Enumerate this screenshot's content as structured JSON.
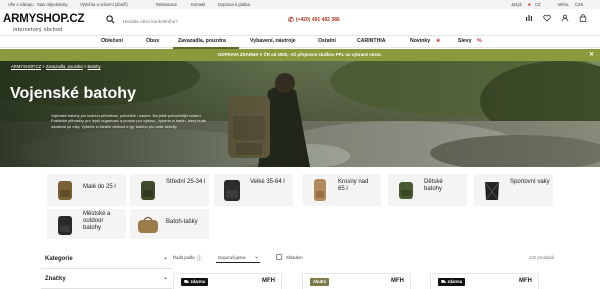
{
  "topbar": {
    "left": [
      "Vše o nákupu",
      "Stav objednávky",
      "Výměna a vrácení (zboží)",
      "Reklamace",
      "Kontakt",
      "Doprava a platba"
    ],
    "jazyk_label": "Jazyk",
    "jazyk_value": "CZ",
    "mena_label": "Měna",
    "mena_value": "CZK"
  },
  "header": {
    "logo": "ARMYSHOP.CZ",
    "logo_sub": "internetový obchod",
    "search_placeholder": "Hledáte něco konkrétního?",
    "phone": "(+420) 491 482 386"
  },
  "nav": {
    "items": [
      "Oblečení",
      "Obuv",
      "Zavazadla, pouzdra",
      "Vybavení, nástroje",
      "Ostatní",
      "CARINTHIA",
      "Novinky",
      "Slevy"
    ]
  },
  "banner": {
    "text": "DOPRAVA ZDARMA V ČR od 1500,- Kč přepravní službou PPL na vybrané místo.",
    "close": "✕"
  },
  "hero": {
    "breadcrumb": [
      "ARMYSHOP.CZ",
      "Zavazadla, pouzdra",
      "Batohy"
    ],
    "title": "Vojenské batohy",
    "text": "Vojenské batohy pro každou příležitost, pohodlné i odolné. Na ještě pohodlnější nošení. Praktické přihrádky pro lepší organizaci a prostor pro výbavu. Vyberte si batoh, který bude odolávat po roky. Vyberte si ideální velikost a typ batohu pro vaše aktivity."
  },
  "categories": [
    {
      "label": "Malé do 25 l",
      "color": "#7a6236"
    },
    {
      "label": "Střední 25-34 l",
      "color": "#3f4a2a"
    },
    {
      "label": "Velké 35-64 l",
      "color": "#2b2d2b"
    },
    {
      "label": "Krosny nad 65 l",
      "color": "#b08a5a"
    },
    {
      "label": "Dětské batohy",
      "color": "#4a5a30"
    },
    {
      "label": "Sportovní vaky",
      "color": "#222222"
    },
    {
      "label": "Městské a outdoor batohy",
      "color": "#2a2a2a"
    },
    {
      "label": "Batoh-tašky",
      "color": "#9c7b4a"
    }
  ],
  "filters": {
    "items": [
      "Kategorie",
      "Značky"
    ]
  },
  "sort": {
    "label": "Řadit podle",
    "value": "Doporučujeme",
    "stock_label": "Skladem",
    "count": "232 produktů"
  },
  "products": [
    {
      "badge": "zdarma",
      "badge_color": "#111111",
      "brand": "MFH"
    },
    {
      "badge": "Akutní",
      "badge_color": "#7d7a4a",
      "brand": "MFH"
    },
    {
      "badge": "zdarma",
      "badge_color": "#111111",
      "brand": "MFH"
    }
  ],
  "colors": {
    "accent": "#8c9a3e",
    "phone": "#b03a20"
  }
}
